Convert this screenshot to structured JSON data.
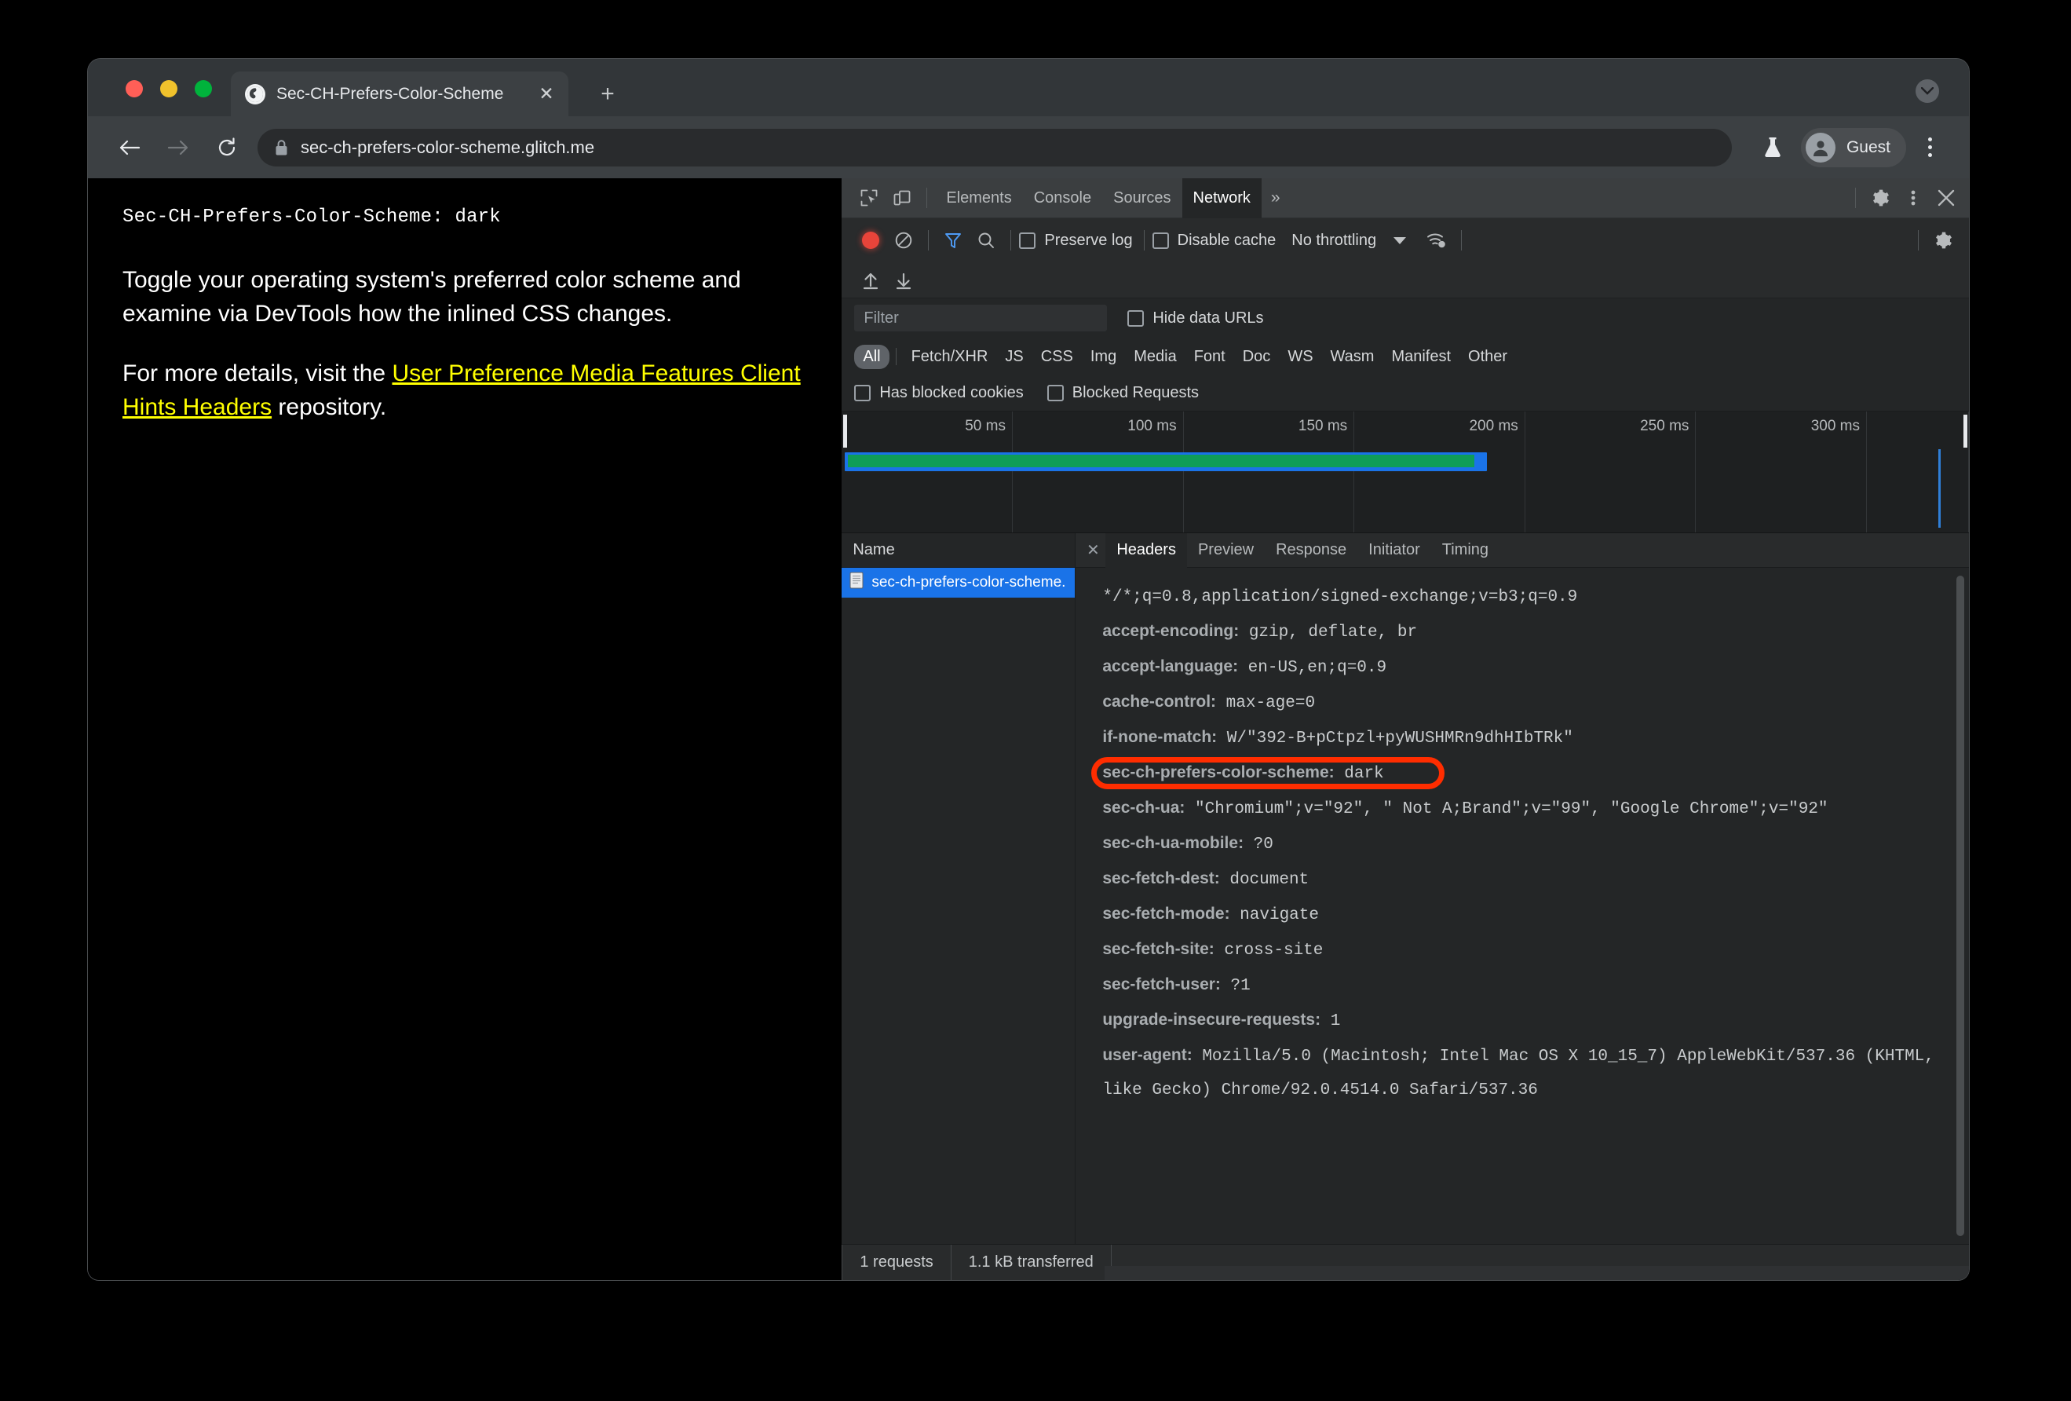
{
  "browser": {
    "tab": {
      "title": "Sec-CH-Prefers-Color-Scheme",
      "close_label": "✕",
      "favicon": "globe-icon"
    },
    "new_tab_label": "+",
    "url": "sec-ch-prefers-color-scheme.glitch.me",
    "profile_name": "Guest",
    "nav": {
      "back": "←",
      "forward": "→",
      "reload": "↻"
    }
  },
  "page": {
    "header_line": "Sec-CH-Prefers-Color-Scheme: dark",
    "paragraph1": "Toggle your operating system's preferred color scheme and examine via DevTools how the inlined CSS changes.",
    "paragraph2_before": "For more details, visit the ",
    "link_text": "User Preference Media Features Client Hints Headers",
    "paragraph2_after": " repository."
  },
  "devtools": {
    "panels": [
      "Elements",
      "Console",
      "Sources",
      "Network"
    ],
    "active_panel": "Network",
    "more_panels_label": "»",
    "network_toolbar": {
      "preserve_log": "Preserve log",
      "disable_cache": "Disable cache",
      "throttling": "No throttling"
    },
    "filter": {
      "placeholder": "Filter",
      "hide_data_urls": "Hide data URLs",
      "types": [
        "All",
        "Fetch/XHR",
        "JS",
        "CSS",
        "Img",
        "Media",
        "Font",
        "Doc",
        "WS",
        "Wasm",
        "Manifest",
        "Other"
      ],
      "active_type": "All",
      "has_blocked_cookies": "Has blocked cookies",
      "blocked_requests": "Blocked Requests"
    },
    "overview": {
      "ticks": [
        "50 ms",
        "100 ms",
        "150 ms",
        "200 ms",
        "250 ms",
        "300 ms"
      ]
    },
    "requests": {
      "column_header": "Name",
      "rows": [
        {
          "name": "sec-ch-prefers-color-scheme...",
          "selected": true
        }
      ]
    },
    "detail_tabs": [
      "Headers",
      "Preview",
      "Response",
      "Initiator",
      "Timing"
    ],
    "active_detail_tab": "Headers",
    "close_detail_label": "✕",
    "headers": [
      {
        "name": "",
        "value": "*/*;q=0.8,application/signed-exchange;v=b3;q=0.9"
      },
      {
        "name": "accept-encoding:",
        "value": " gzip, deflate, br"
      },
      {
        "name": "accept-language:",
        "value": " en-US,en;q=0.9"
      },
      {
        "name": "cache-control:",
        "value": " max-age=0"
      },
      {
        "name": "if-none-match:",
        "value": " W/\"392-B+pCtpzl+pyWUSHMRn9dhHIbTRk\""
      },
      {
        "name": "sec-ch-prefers-color-scheme:",
        "value": " dark",
        "highlighted": true
      },
      {
        "name": "sec-ch-ua:",
        "value": " \"Chromium\";v=\"92\", \" Not A;Brand\";v=\"99\", \"Google Chrome\";v=\"92\""
      },
      {
        "name": "sec-ch-ua-mobile:",
        "value": " ?0"
      },
      {
        "name": "sec-fetch-dest:",
        "value": " document"
      },
      {
        "name": "sec-fetch-mode:",
        "value": " navigate"
      },
      {
        "name": "sec-fetch-site:",
        "value": " cross-site"
      },
      {
        "name": "sec-fetch-user:",
        "value": " ?1"
      },
      {
        "name": "upgrade-insecure-requests:",
        "value": " 1"
      },
      {
        "name": "user-agent:",
        "value": " Mozilla/5.0 (Macintosh; Intel Mac OS X 10_15_7) AppleWebKit/537.36 (KHTML, like Gecko) Chrome/92.0.4514.0 Safari/537.36"
      }
    ],
    "status": {
      "requests": "1 requests",
      "transferred": "1.1 kB transferred"
    }
  },
  "colors": {
    "accent_blue": "#1a73e8",
    "link_yellow": "#ffff00",
    "highlight_red": "#ff2d00",
    "waterfall_green": "#0f9d58"
  }
}
